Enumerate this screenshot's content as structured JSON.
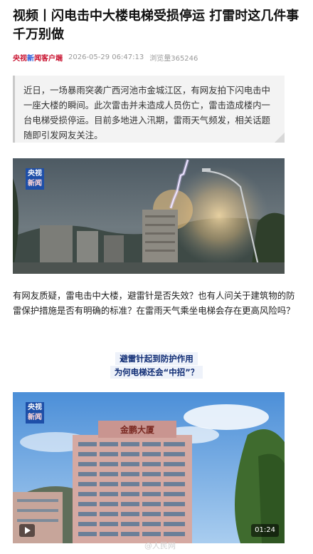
{
  "article": {
    "title": "视频丨闪电击中大楼电梯受损停运 打雷时这几件事千万别做",
    "source": {
      "part1": "央视",
      "part2": "新",
      "part3": "闻客户端"
    },
    "timestamp": "2026-05-29 06:47:13",
    "views": "浏览量365246",
    "summary": "近日，一场暴雨突袭广西河池市金城江区，有网友拍下闪电击中一座大楼的瞬间。此次雷击并未造成人员伤亡，雷击造成楼内一台电梯受损停运。目前多地进入汛期，雷雨天气频发，相关话题随即引发网友关注。",
    "body": "有网友质疑，雷电击中大楼，避雷针是否失效？也有人问关于建筑物的防雷保护措施是否有明确的标准？在雷雨天气乘坐电梯会存在更高风险吗？",
    "caption": {
      "line1": "避雷针起到防护作用",
      "line2": "为何电梯还会“中招”？"
    }
  },
  "media": {
    "logo": {
      "top": "央视",
      "bottom": "新闻"
    },
    "video": {
      "duration": "01:24",
      "building_sign": "金鹏大厦"
    }
  },
  "watermark": "@人民网",
  "colors": {
    "accent_red": "#c8102e",
    "caption_blue": "#0d2a73",
    "logo_blue": "#1e4fa8"
  },
  "icons": [
    "play-icon"
  ]
}
